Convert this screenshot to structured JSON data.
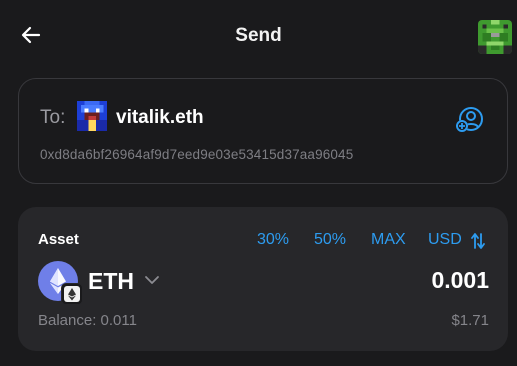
{
  "header": {
    "title": "Send",
    "back_icon": "arrow-left-icon",
    "avatar_icon": "wallet-avatar"
  },
  "recipient": {
    "to_label": "To:",
    "name": "vitalik.eth",
    "address": "0xd8da6bf26964af9d7eed9e03e53415d37aa96045",
    "contacts_icon": "contacts-icon"
  },
  "asset": {
    "label": "Asset",
    "presets": [
      "30%",
      "50%",
      "MAX"
    ],
    "currency": "USD",
    "token_symbol": "ETH",
    "amount": "0.001",
    "balance": "Balance: 0.011",
    "fiat_value": "$1.71"
  },
  "colors": {
    "background": "#1a1a1c",
    "card": "#27272a",
    "accent": "#2d9cf0",
    "muted_text": "#85858b",
    "eth": "#6f7fe8"
  }
}
